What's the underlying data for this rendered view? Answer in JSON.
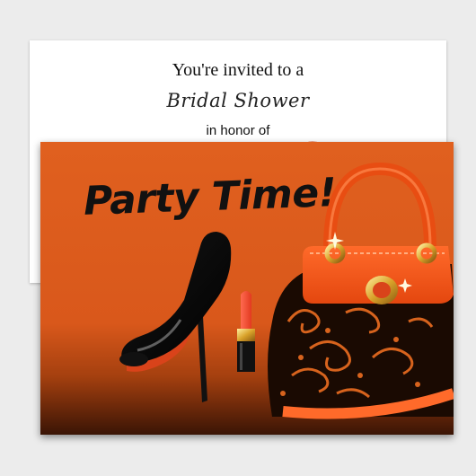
{
  "invitation": {
    "line1": "You're invited to a",
    "line2": "Bridal Shower",
    "line3": "in honor of"
  },
  "card": {
    "headline": "Party Time!"
  },
  "colors": {
    "orange": "#e0601f",
    "dark_orange": "#a5400f",
    "black": "#111111",
    "white": "#ffffff",
    "gold": "#e0b040"
  },
  "icons": [
    "high-heel-shoe-icon",
    "lipstick-icon",
    "handbag-icon",
    "sparkle-icon"
  ]
}
